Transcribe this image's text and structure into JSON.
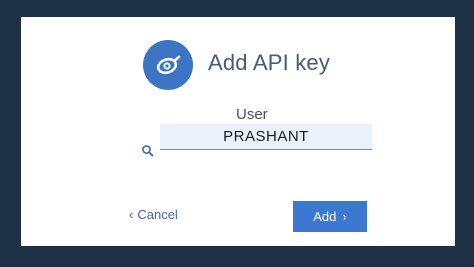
{
  "dialog": {
    "title": "Add API key",
    "icon": "key-icon"
  },
  "user_field": {
    "label": "User",
    "value": "PRASHANT",
    "icon": "search-icon"
  },
  "actions": {
    "cancel_label": "Cancel",
    "cancel_icon": "chevron-left-icon",
    "add_label": "Add",
    "add_icon": "chevron-right-icon"
  },
  "colors": {
    "background": "#1d3044",
    "card": "#ffffff",
    "accent": "#3c78cf",
    "input_fill": "#e9f1fb",
    "title_text": "#4a5a78"
  }
}
